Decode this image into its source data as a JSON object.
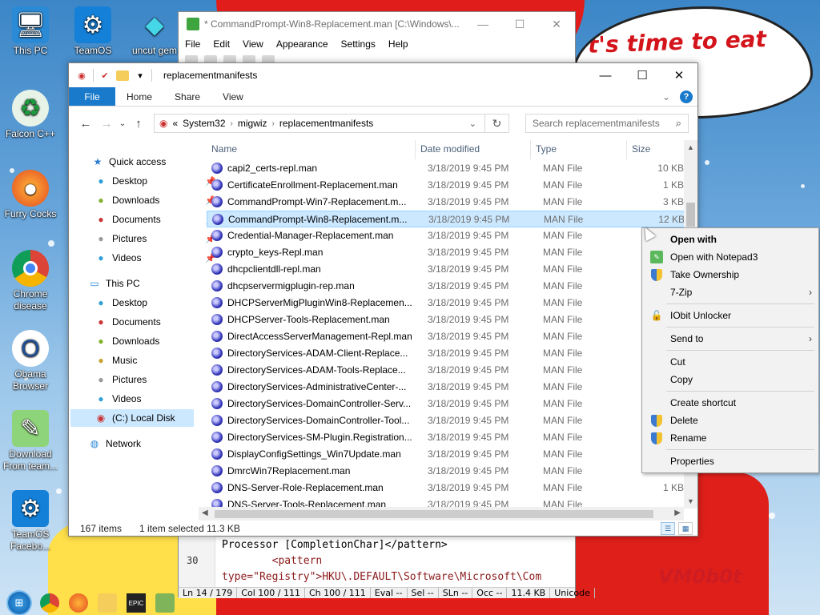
{
  "desktop": {
    "icons": [
      {
        "label": "This PC",
        "icon": "monitor-icon"
      },
      {
        "label": "TeamOS",
        "icon": "gear-icon"
      },
      {
        "label": "uncut gem",
        "icon": "gem-icon"
      },
      {
        "label": "Falcon C++",
        "icon": "recycle-icon"
      },
      {
        "label": "Furry Cocks",
        "icon": "firefox-icon"
      },
      {
        "label": "Chrome\ndisease",
        "icon": "chrome-icon"
      },
      {
        "label": "Obama\nBrowser",
        "icon": "obama-icon"
      },
      {
        "label": "Download\nFrom team...",
        "icon": "notepad-icon"
      },
      {
        "label": "TeamOS\nFacebo...",
        "icon": "gear-icon"
      }
    ],
    "bubble_text": "t's time to eat shit\nl chew\nes",
    "watermark": "VM0b0t",
    "colors": {
      "santa_red": "#e01d1b",
      "sky": "#3c86c7",
      "accent": "#1979ca"
    }
  },
  "notepad3": {
    "title": "* CommandPrompt-Win8-Replacement.man [C:\\Windows\\...",
    "menu": [
      "File",
      "Edit",
      "View",
      "Appearance",
      "Settings",
      "Help"
    ],
    "line_number": "30",
    "code_lines": [
      "Processor [CompletionChar]</pattern>",
      "        <pattern",
      "type=\"Registry\">HKU\\.DEFAULT\\Software\\Microsoft\\Com"
    ],
    "status": [
      "Ln  14 / 179",
      "Col  100 / 111",
      "Ch  100 / 111",
      "Eval  --",
      "Sel  --",
      "SLn  --",
      "Occ  --",
      "11.4 KB",
      "Unicode"
    ]
  },
  "explorer": {
    "title": "replacementmanifests",
    "ribbon_tabs": [
      "File",
      "Home",
      "Share",
      "View"
    ],
    "breadcrumb": [
      "«",
      "System32",
      "migwiz",
      "replacementmanifests"
    ],
    "search_placeholder": "Search replacementmanifests",
    "nav": {
      "quick_access": "Quick access",
      "quick_items": [
        "Desktop",
        "Downloads",
        "Documents",
        "Pictures",
        "Videos"
      ],
      "this_pc": "This PC",
      "pc_items": [
        "Desktop",
        "Documents",
        "Downloads",
        "Music",
        "Pictures",
        "Videos",
        "(C:) Local Disk"
      ],
      "network": "Network"
    },
    "columns": {
      "name": "Name",
      "date": "Date modified",
      "type": "Type",
      "size": "Size"
    },
    "files": [
      {
        "name": "capi2_certs-repl.man",
        "date": "3/18/2019 9:45 PM",
        "type": "MAN File",
        "size": "10 KB"
      },
      {
        "name": "CertificateEnrollment-Replacement.man",
        "date": "3/18/2019 9:45 PM",
        "type": "MAN File",
        "size": "1 KB"
      },
      {
        "name": "CommandPrompt-Win7-Replacement.m...",
        "date": "3/18/2019 9:45 PM",
        "type": "MAN File",
        "size": "3 KB"
      },
      {
        "name": "CommandPrompt-Win8-Replacement.m...",
        "date": "3/18/2019 9:45 PM",
        "type": "MAN File",
        "size": "12 KB"
      },
      {
        "name": "Credential-Manager-Replacement.man",
        "date": "3/18/2019 9:45 PM",
        "type": "MAN File",
        "size": ""
      },
      {
        "name": "crypto_keys-Repl.man",
        "date": "3/18/2019 9:45 PM",
        "type": "MAN File",
        "size": ""
      },
      {
        "name": "dhcpclientdll-repl.man",
        "date": "3/18/2019 9:45 PM",
        "type": "MAN File",
        "size": ""
      },
      {
        "name": "dhcpservermigplugin-rep.man",
        "date": "3/18/2019 9:45 PM",
        "type": "MAN File",
        "size": ""
      },
      {
        "name": "DHCPServerMigPluginWin8-Replacemen...",
        "date": "3/18/2019 9:45 PM",
        "type": "MAN File",
        "size": ""
      },
      {
        "name": "DHCPServer-Tools-Replacement.man",
        "date": "3/18/2019 9:45 PM",
        "type": "MAN File",
        "size": ""
      },
      {
        "name": "DirectAccessServerManagement-Repl.man",
        "date": "3/18/2019 9:45 PM",
        "type": "MAN File",
        "size": ""
      },
      {
        "name": "DirectoryServices-ADAM-Client-Replace...",
        "date": "3/18/2019 9:45 PM",
        "type": "MAN File",
        "size": ""
      },
      {
        "name": "DirectoryServices-ADAM-Tools-Replace...",
        "date": "3/18/2019 9:45 PM",
        "type": "MAN File",
        "size": ""
      },
      {
        "name": "DirectoryServices-AdministrativeCenter-...",
        "date": "3/18/2019 9:45 PM",
        "type": "MAN File",
        "size": ""
      },
      {
        "name": "DirectoryServices-DomainController-Serv...",
        "date": "3/18/2019 9:45 PM",
        "type": "MAN File",
        "size": ""
      },
      {
        "name": "DirectoryServices-DomainController-Tool...",
        "date": "3/18/2019 9:45 PM",
        "type": "MAN File",
        "size": ""
      },
      {
        "name": "DirectoryServices-SM-Plugin.Registration...",
        "date": "3/18/2019 9:45 PM",
        "type": "MAN File",
        "size": ""
      },
      {
        "name": "DisplayConfigSettings_Win7Update.man",
        "date": "3/18/2019 9:45 PM",
        "type": "MAN File",
        "size": ""
      },
      {
        "name": "DmrcWin7Replacement.man",
        "date": "3/18/2019 9:45 PM",
        "type": "MAN File",
        "size": ""
      },
      {
        "name": "DNS-Server-Role-Replacement.man",
        "date": "3/18/2019 9:45 PM",
        "type": "MAN File",
        "size": "1 KB"
      },
      {
        "name": "DNS-Server-Tools-Replacement.man",
        "date": "3/18/2019 9:45 PM",
        "type": "MAN File",
        "size": ""
      }
    ],
    "selected_index": 3,
    "status_count": "167 items",
    "status_selected": "1 item selected  11.3 KB"
  },
  "context_menu": {
    "items": [
      {
        "label": "Open with",
        "bold": true,
        "icon": ""
      },
      {
        "label": "Open with Notepad3",
        "icon": "notepad3-icon"
      },
      {
        "label": "Take Ownership",
        "icon": "shield-icon"
      },
      {
        "label": "7-Zip",
        "icon": "",
        "submenu": true
      },
      {
        "label": "IObit Unlocker",
        "icon": "unlocker-icon"
      },
      {
        "label": "Send to",
        "icon": "",
        "submenu": true
      },
      {
        "label": "Cut",
        "icon": ""
      },
      {
        "label": "Copy",
        "icon": ""
      },
      {
        "label": "Create shortcut",
        "icon": ""
      },
      {
        "label": "Delete",
        "icon": "shield-icon"
      },
      {
        "label": "Rename",
        "icon": "shield-icon"
      },
      {
        "label": "Properties",
        "icon": ""
      }
    ]
  }
}
